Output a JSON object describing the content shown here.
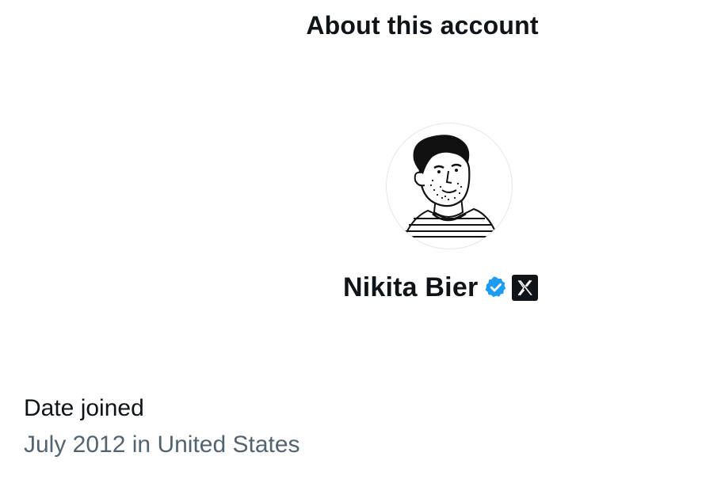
{
  "header": {
    "title": "About this account"
  },
  "profile": {
    "avatar_icon": "user-portrait-sketch",
    "display_name": "Nikita Bier",
    "verified_badge_icon": "verified-badge-icon",
    "verified_color": "#1d9bf0",
    "affiliate_icon": "x-logo-icon"
  },
  "details": {
    "date_joined_label": "Date joined",
    "date_joined_value": "July 2012 in United States"
  },
  "colors": {
    "text_primary": "#0f1419",
    "text_secondary": "#536471",
    "background": "#ffffff"
  }
}
